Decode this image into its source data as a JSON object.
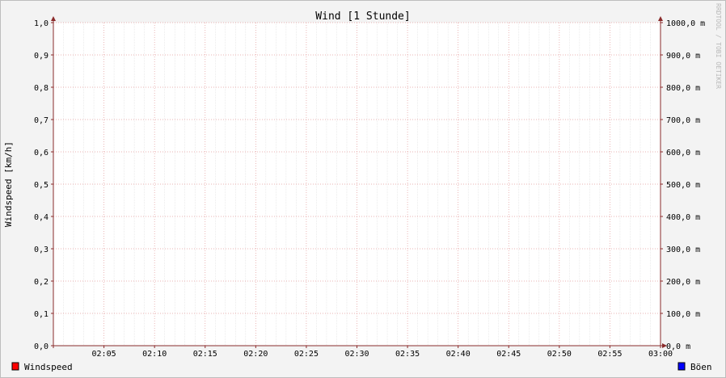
{
  "chart_data": {
    "type": "line",
    "title": "Wind [1 Stunde]",
    "ylabel": "Windspeed [km/h]",
    "watermark": "RRDTOOL / TOBI OETIKER",
    "ylim": [
      0,
      1.0
    ],
    "y_ticks": [
      "0,0",
      "0,1",
      "0,2",
      "0,3",
      "0,4",
      "0,5",
      "0,6",
      "0,7",
      "0,8",
      "0,9",
      "1,0"
    ],
    "y2_ticks": [
      "0,0 m",
      "100,0 m",
      "200,0 m",
      "300,0 m",
      "400,0 m",
      "500,0 m",
      "600,0 m",
      "700,0 m",
      "800,0 m",
      "900,0 m",
      "1000,0 m"
    ],
    "x_ticks": [
      "02:05",
      "02:10",
      "02:15",
      "02:20",
      "02:25",
      "02:30",
      "02:35",
      "02:40",
      "02:45",
      "02:50",
      "02:55",
      "03:00"
    ],
    "series": [
      {
        "name": "Windspeed",
        "color": "#ff0000",
        "values": [
          0,
          0
        ]
      },
      {
        "name": "Böen",
        "color": "#0000ff",
        "values": [
          0,
          0
        ]
      }
    ]
  },
  "colors": {
    "background": "#f3f3f3",
    "plot_bg": "#ffffff",
    "major_grid": "#e39a9a",
    "minor_grid": "#d9d9d9",
    "axis": "#8a2b2b"
  }
}
